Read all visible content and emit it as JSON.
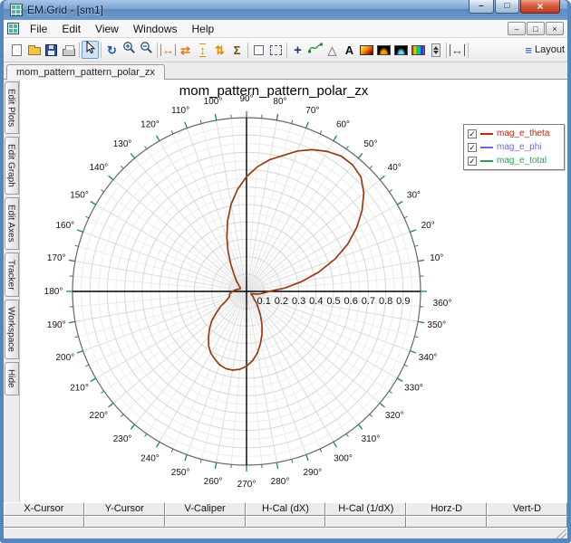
{
  "window": {
    "title": "EM.Grid - [sm1]",
    "buttons": [
      {
        "name": "minimize-button",
        "glyph": "–"
      },
      {
        "name": "maximize-button",
        "glyph": "□"
      },
      {
        "name": "close-button",
        "glyph": "×"
      }
    ]
  },
  "menubar": {
    "items": [
      "File",
      "Edit",
      "View",
      "Windows",
      "Help"
    ],
    "mdi_buttons": [
      {
        "name": "mdi-minimize-button",
        "glyph": "–"
      },
      {
        "name": "mdi-restore-button",
        "glyph": "□"
      },
      {
        "name": "mdi-close-button",
        "glyph": "×"
      }
    ]
  },
  "toolbar": {
    "layout_label": "Layout",
    "layout_icon": {
      "name": "layout-icon",
      "glyph": "≡"
    },
    "icons": [
      {
        "name": "new-document-icon",
        "kind": "art",
        "art": "page"
      },
      {
        "name": "open-file-icon",
        "kind": "art",
        "art": "folder"
      },
      {
        "name": "save-icon",
        "kind": "art",
        "art": "floppy"
      },
      {
        "name": "print-icon",
        "kind": "art",
        "art": "printer"
      },
      {
        "kind": "sep"
      },
      {
        "name": "pointer-icon",
        "kind": "art",
        "art": "arrow",
        "selected": true
      },
      {
        "kind": "sep"
      },
      {
        "name": "redraw-icon",
        "kind": "glyph",
        "glyph": "↻",
        "color": "#1a56b0",
        "bold": true
      },
      {
        "name": "zoom-in-icon",
        "kind": "art",
        "art": "magplus"
      },
      {
        "name": "zoom-out-icon",
        "kind": "art",
        "art": "magminus"
      },
      {
        "kind": "sep"
      },
      {
        "name": "fit-width-icon",
        "kind": "glyph",
        "glyph": "↔",
        "color": "#e07818",
        "bold": true,
        "bars": "h"
      },
      {
        "name": "pan-horizontal-icon",
        "kind": "glyph",
        "glyph": "⇄",
        "color": "#e07818",
        "bold": true
      },
      {
        "name": "fit-height-icon",
        "kind": "glyph",
        "glyph": "↕",
        "color": "#d89010",
        "bold": true,
        "bars": "v"
      },
      {
        "name": "pan-vertical-icon",
        "kind": "glyph",
        "glyph": "⇅",
        "color": "#d89010",
        "bold": true
      },
      {
        "name": "sum-icon",
        "kind": "glyph",
        "glyph": "Σ",
        "color": "#6b4e00",
        "bold": true
      },
      {
        "kind": "sep"
      },
      {
        "name": "checkbox-tool-icon",
        "kind": "art",
        "art": "box"
      },
      {
        "name": "select-region-icon",
        "kind": "art",
        "art": "dashedbox"
      },
      {
        "kind": "sep"
      },
      {
        "name": "crosshair-icon",
        "kind": "glyph",
        "glyph": "+",
        "color": "#20356e",
        "bold": true,
        "size": 15
      },
      {
        "name": "curve-tool-icon",
        "kind": "art",
        "art": "curve"
      },
      {
        "name": "marker-tool-icon",
        "kind": "glyph",
        "glyph": "△",
        "color": "#555"
      },
      {
        "name": "text-tool-icon",
        "kind": "glyph",
        "glyph": "A",
        "color": "#111",
        "bold": true
      },
      {
        "name": "colormap-icon",
        "kind": "art",
        "art": "colormap"
      },
      {
        "name": "spectrogram-icon",
        "kind": "art",
        "art": "spectrum1"
      },
      {
        "name": "waveform-icon",
        "kind": "art",
        "art": "spectrum2"
      },
      {
        "name": "palette-icon",
        "kind": "art",
        "art": "palette"
      },
      {
        "name": "spin-control-icon",
        "kind": "art",
        "art": "spin"
      },
      {
        "kind": "sep"
      },
      {
        "name": "caliper-icon",
        "kind": "glyph",
        "glyph": "↔",
        "color": "#555",
        "bars": "h"
      },
      {
        "kind": "sep"
      }
    ]
  },
  "tabbar": {
    "tabs": [
      {
        "label": "mom_pattern_pattern_polar_zx",
        "active": true
      }
    ]
  },
  "sidebar": {
    "tabs": [
      "Edit Plots",
      "Edit Graph",
      "Edit Axes",
      "Tracker",
      "Workspace",
      "Hide"
    ]
  },
  "legend": {
    "items": [
      {
        "label": "mag_e_theta",
        "color": "#cc2200",
        "checked": true
      },
      {
        "label": "mag_e_phi",
        "color": "#6a6ad0",
        "checked": true
      },
      {
        "label": "mag_e_total",
        "color": "#2e9e5b",
        "checked": true
      }
    ]
  },
  "chart_data": {
    "type": "polar",
    "title": "mom_pattern_pattern_polar_zx",
    "angle_unit": "degrees",
    "angle_zero": "right",
    "angle_direction": "counterclockwise",
    "radial_range": [
      0,
      1.0
    ],
    "ring_step": 0.05,
    "ring_major_step": 0.1,
    "grid": true,
    "tick_color": "#1f8080",
    "legend_position": "top-right",
    "angle_labels": [
      10,
      20,
      30,
      40,
      50,
      60,
      70,
      80,
      90,
      100,
      110,
      120,
      130,
      140,
      150,
      160,
      170,
      180,
      190,
      200,
      210,
      220,
      230,
      240,
      250,
      260,
      270,
      280,
      290,
      300,
      310,
      320,
      330,
      340,
      350,
      360
    ],
    "radial_labels": [
      "0.1",
      "0.2",
      "0.3",
      "0.4",
      "0.5",
      "0.6",
      "0.7",
      "0.8",
      "0.9"
    ],
    "series": [
      {
        "name": "mag_e_theta",
        "color": "#9a3a12",
        "points": [
          [
            0,
            0.13
          ],
          [
            5,
            0.22
          ],
          [
            10,
            0.32
          ],
          [
            15,
            0.43
          ],
          [
            20,
            0.54
          ],
          [
            25,
            0.64
          ],
          [
            30,
            0.73
          ],
          [
            35,
            0.81
          ],
          [
            40,
            0.88
          ],
          [
            45,
            0.93
          ],
          [
            50,
            0.95
          ],
          [
            55,
            0.95
          ],
          [
            60,
            0.93
          ],
          [
            65,
            0.9
          ],
          [
            70,
            0.86
          ],
          [
            75,
            0.81
          ],
          [
            80,
            0.77
          ],
          [
            85,
            0.72
          ],
          [
            90,
            0.66
          ],
          [
            95,
            0.59
          ],
          [
            100,
            0.51
          ],
          [
            105,
            0.42
          ],
          [
            110,
            0.33
          ],
          [
            115,
            0.25
          ],
          [
            120,
            0.18
          ],
          [
            125,
            0.13
          ],
          [
            130,
            0.1
          ],
          [
            135,
            0.08
          ],
          [
            140,
            0.06
          ],
          [
            145,
            0.05
          ],
          [
            150,
            0.04
          ],
          [
            155,
            0.04
          ],
          [
            160,
            0.04
          ],
          [
            165,
            0.05
          ],
          [
            170,
            0.06
          ],
          [
            175,
            0.07
          ],
          [
            180,
            0.08
          ],
          [
            185,
            0.09
          ],
          [
            190,
            0.1
          ],
          [
            195,
            0.1
          ],
          [
            200,
            0.11
          ],
          [
            205,
            0.13
          ],
          [
            210,
            0.17
          ],
          [
            215,
            0.21
          ],
          [
            220,
            0.26
          ],
          [
            225,
            0.3
          ],
          [
            230,
            0.34
          ],
          [
            235,
            0.38
          ],
          [
            240,
            0.41
          ],
          [
            245,
            0.43
          ],
          [
            250,
            0.45
          ],
          [
            255,
            0.46
          ],
          [
            260,
            0.46
          ],
          [
            265,
            0.45
          ],
          [
            270,
            0.43
          ],
          [
            275,
            0.4
          ],
          [
            280,
            0.36
          ],
          [
            285,
            0.31
          ],
          [
            290,
            0.26
          ],
          [
            295,
            0.21
          ],
          [
            300,
            0.16
          ],
          [
            305,
            0.12
          ],
          [
            310,
            0.09
          ],
          [
            315,
            0.06
          ],
          [
            320,
            0.05
          ],
          [
            325,
            0.04
          ],
          [
            330,
            0.03
          ],
          [
            335,
            0.03
          ],
          [
            340,
            0.04
          ],
          [
            345,
            0.06
          ],
          [
            350,
            0.08
          ],
          [
            355,
            0.1
          ],
          [
            360,
            0.13
          ]
        ]
      },
      {
        "name": "mag_e_phi",
        "color": "#6a6ad0",
        "points": []
      },
      {
        "name": "mag_e_total",
        "color": "#2e9e5b",
        "points": []
      }
    ]
  },
  "measure_table": {
    "columns": [
      "X-Cursor",
      "Y-Cursor",
      "V-Caliper",
      "H-Cal (dX)",
      "H-Cal (1/dX)",
      "Horz-D",
      "Vert-D"
    ],
    "rows": [
      [
        "",
        "",
        "",
        "",
        "",
        "",
        ""
      ]
    ]
  }
}
